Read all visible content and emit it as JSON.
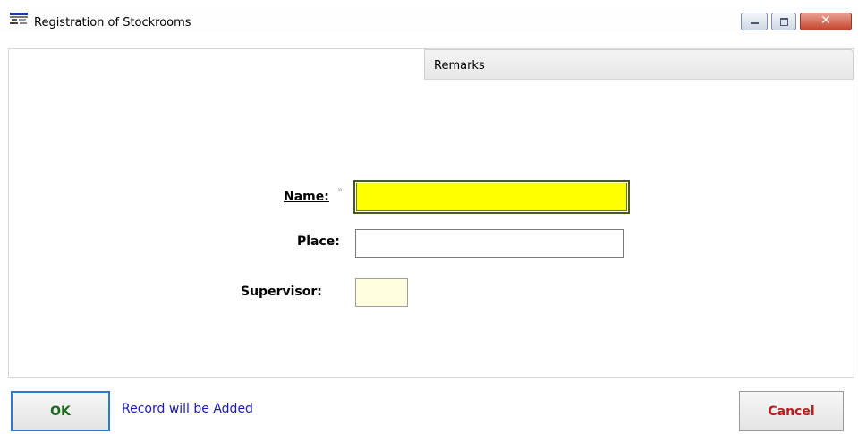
{
  "window": {
    "title": "Registration of Stockrooms",
    "icons": [
      "app-icon",
      "minimize-icon",
      "maximize-icon",
      "close-icon"
    ],
    "close_glyph": "✕"
  },
  "tabs": [
    {
      "label": "Remarks"
    }
  ],
  "form": {
    "name_label": "Name:",
    "name_marker": "»",
    "name_value": "",
    "place_label": "Place:",
    "place_value": "",
    "supervisor_label": "Supervisor:",
    "supervisor_value": ""
  },
  "footer": {
    "ok_label": "OK",
    "status": "Record will be Added",
    "cancel_label": "Cancel"
  },
  "colors": {
    "name_field_bg": "#ffff00",
    "supervisor_field_bg": "#ffffe0",
    "ok_text": "#1c6b1c",
    "cancel_text": "#c0191b",
    "status_text": "#1a1ab8"
  }
}
